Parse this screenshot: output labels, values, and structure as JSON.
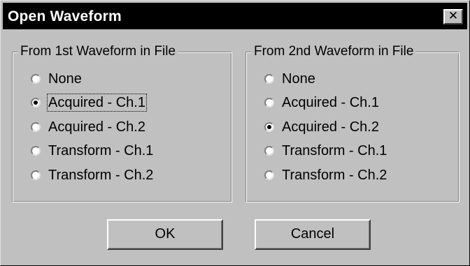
{
  "window": {
    "title": "Open Waveform",
    "close_glyph": "✕"
  },
  "groups": [
    {
      "legend": "From 1st Waveform in File",
      "options": [
        {
          "label": "None",
          "checked": false
        },
        {
          "label": "Acquired - Ch.1",
          "checked": true,
          "focused": true
        },
        {
          "label": "Acquired - Ch.2",
          "checked": false
        },
        {
          "label": "Transform - Ch.1",
          "checked": false
        },
        {
          "label": "Transform - Ch.2",
          "checked": false
        }
      ]
    },
    {
      "legend": "From 2nd Waveform in File",
      "options": [
        {
          "label": "None",
          "checked": false
        },
        {
          "label": "Acquired - Ch.1",
          "checked": false
        },
        {
          "label": "Acquired - Ch.2",
          "checked": true
        },
        {
          "label": "Transform - Ch.1",
          "checked": false
        },
        {
          "label": "Transform - Ch.2",
          "checked": false
        }
      ]
    }
  ],
  "buttons": {
    "ok": "OK",
    "cancel": "Cancel"
  }
}
